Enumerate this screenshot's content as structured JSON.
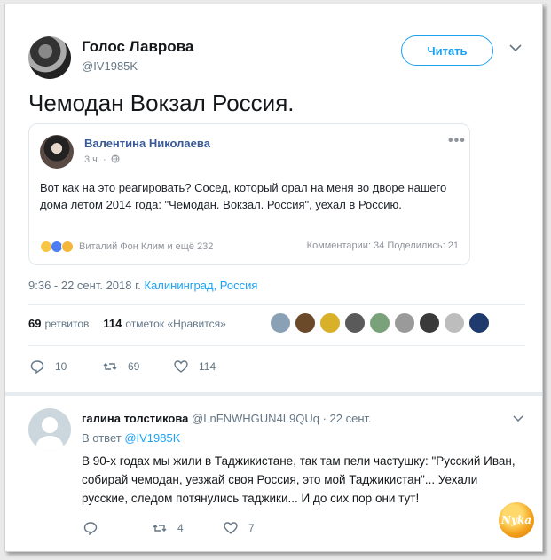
{
  "tweet": {
    "author_name": "Голос Лаврова",
    "author_handle": "@IV1985K",
    "follow_label": "Читать",
    "text": "Чемодан Вокзал Россия.",
    "timestamp": "9:36 - 22 сент. 2018 г.",
    "location": "Калининград, Россия",
    "retweets_count": "69",
    "retweets_label": "ретвитов",
    "likes_count": "114",
    "likes_label": "отметок «Нравится»",
    "actions": {
      "replies": "10",
      "retweets": "69",
      "likes": "114"
    }
  },
  "quote": {
    "name": "Валентина Николаева",
    "meta": "3 ч. ·",
    "dots": "•••",
    "text": "Вот как на это реагировать? Сосед, который орал на меня во дворе нашего дома летом 2014 года: \"Чемодан. Вокзал. Россия\", уехал в Россию.",
    "reactions_label": "Виталий Фон Клим и ещё 232",
    "stats": "Комментарии: 34  Поделились: 21"
  },
  "reply": {
    "name": "галина толстикова",
    "handle": "@LnFNWHGUN4L9QUq",
    "time": "· 22 сент.",
    "reply_prefix": "В ответ",
    "reply_to": "@IV1985K",
    "text": "В 90-х годах мы жили в Таджикистане, так там пели частушку: \"Русский Иван, собирай чемодан, уезжай своя Россия, это мой Таджикистан\"... Уехали русские, следом потянулись таджики... И до сих пор они тут!",
    "actions": {
      "replies": "",
      "retweets": "4",
      "likes": "7"
    }
  },
  "watermark": "Nyka",
  "colors": {
    "accent": "#1da1f2",
    "fb_blue": "#385898",
    "muted": "#657786",
    "like_red": "#e0245e"
  },
  "likers": [
    {
      "color": "#8aa0b4"
    },
    {
      "color": "#6b4a2a"
    },
    {
      "color": "#d8b02a"
    },
    {
      "color": "#5a5a5a"
    },
    {
      "color": "#7aa27a"
    },
    {
      "color": "#9a9a9a"
    },
    {
      "color": "#3a3a3a"
    },
    {
      "color": "#bdbdbd"
    },
    {
      "color": "#1f3b6e"
    }
  ]
}
